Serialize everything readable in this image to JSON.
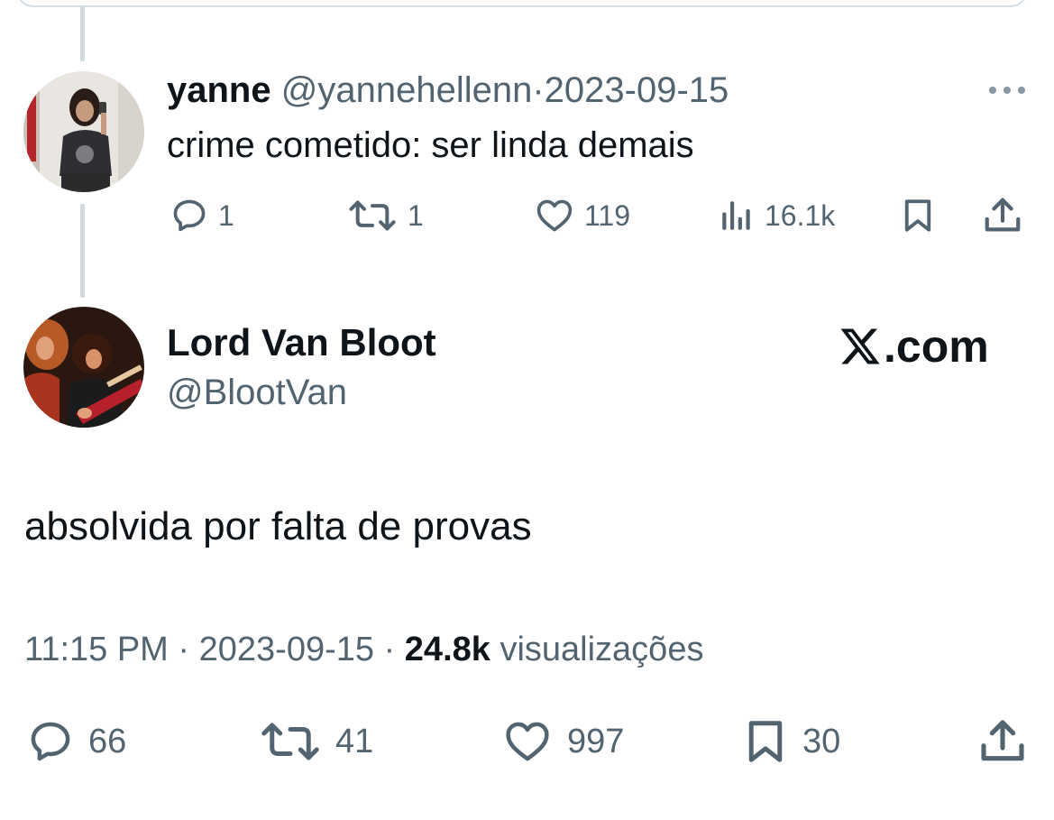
{
  "reply_tweet": {
    "author_name": "yanne",
    "handle": "@yannehellenn",
    "separator": "·",
    "date": "2023-09-15",
    "text": "crime cometido: ser linda demais",
    "more_icon": "more-horizontal-icon",
    "actions": {
      "replies": "1",
      "retweets": "1",
      "likes": "119",
      "views": "16.1k"
    },
    "icons": [
      "reply-icon",
      "retweet-icon",
      "like-icon",
      "views-icon",
      "bookmark-icon",
      "share-icon"
    ]
  },
  "main_tweet": {
    "author_name": "Lord Van Bloot",
    "handle": "@BlootVan",
    "watermark": ".com",
    "watermark_icon": "x-logo-icon",
    "text": "absolvida por falta de provas",
    "time": "11:15 PM",
    "separator": "·",
    "date": "2023-09-15",
    "views_count": "24.8k",
    "views_label": "visualizações",
    "actions": {
      "replies": "66",
      "retweets": "41",
      "likes": "997",
      "bookmarks": "30"
    },
    "icons": [
      "reply-icon",
      "retweet-icon",
      "like-icon",
      "bookmark-icon",
      "share-icon"
    ]
  },
  "colors": {
    "text_primary": "#0f1419",
    "text_secondary": "#536471",
    "thread_line": "#cfd9de",
    "background": "#ffffff"
  }
}
